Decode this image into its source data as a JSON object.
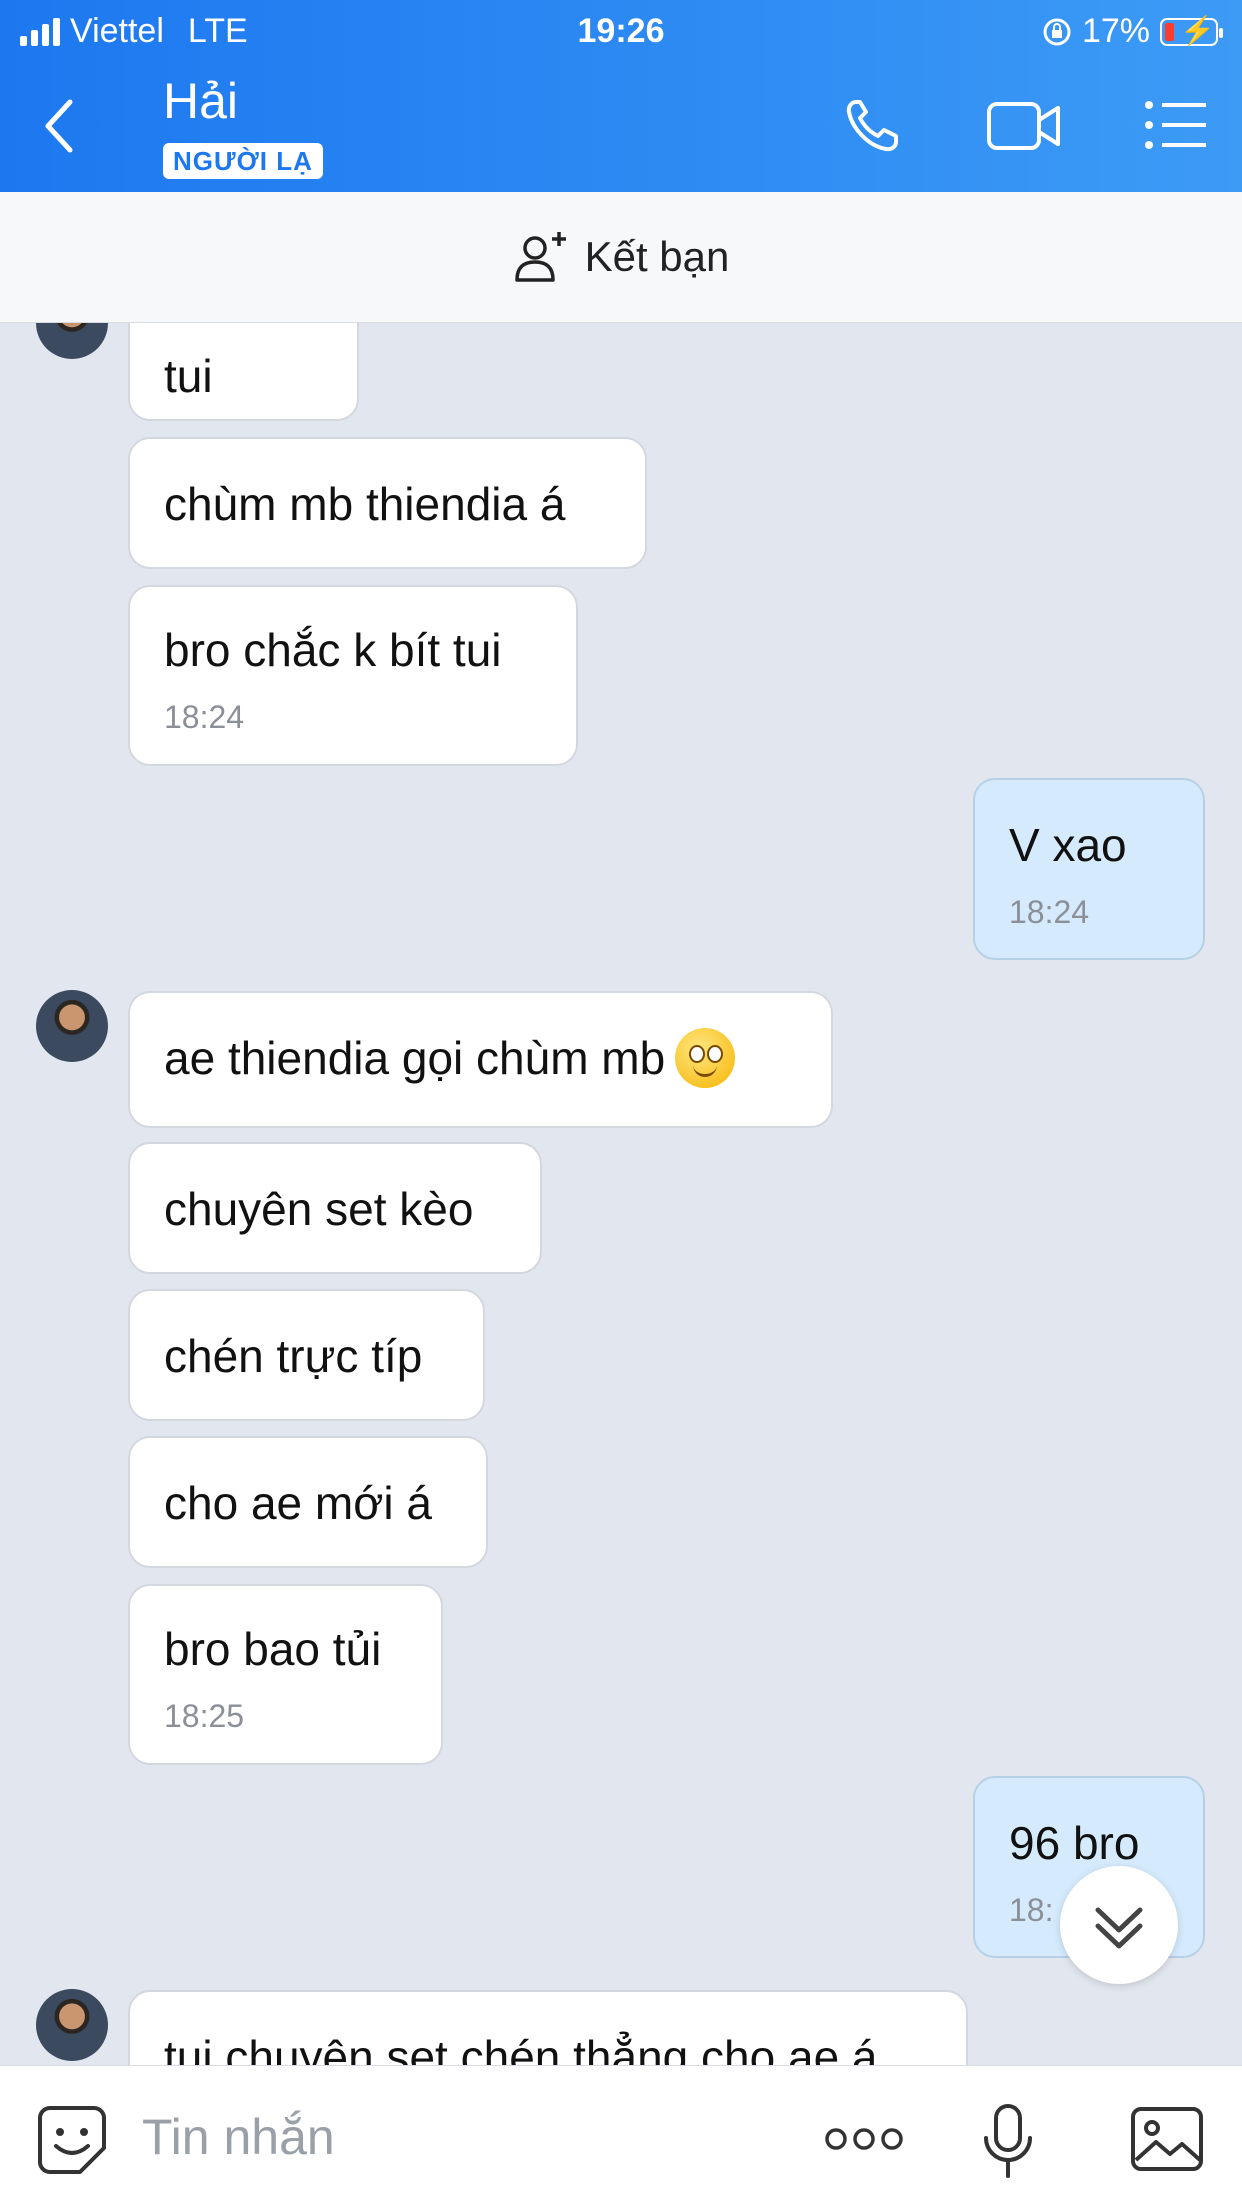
{
  "status_bar": {
    "carrier": "Viettel",
    "network": "LTE",
    "time": "19:26",
    "battery": "17%"
  },
  "header": {
    "contact_name": "Hải",
    "tag": "NGƯỜI LẠ"
  },
  "add_friend": {
    "label": "Kết bạn"
  },
  "messages": [
    {
      "from": "them",
      "text": "tui"
    },
    {
      "from": "them",
      "text": "chùm mb thiendia á"
    },
    {
      "from": "them",
      "text": "bro chắc k bít tui",
      "time": "18:24"
    },
    {
      "from": "me",
      "text": "V xao",
      "time": "18:24"
    },
    {
      "from": "them",
      "text": "ae thiendia gọi chùm mb",
      "emoji": "smile-emoji"
    },
    {
      "from": "them",
      "text": "chuyên set kèo"
    },
    {
      "from": "them",
      "text": "chén trực típ"
    },
    {
      "from": "them",
      "text": "cho ae mới á"
    },
    {
      "from": "them",
      "text": "bro bao tủi",
      "time": "18:25"
    },
    {
      "from": "me",
      "text": "96 bro",
      "time": "18:"
    },
    {
      "from": "them",
      "text": "tui chuyên set chén thẳng cho ae á"
    }
  ],
  "composer": {
    "placeholder": "Tin nhắn"
  },
  "colors": {
    "header": "#1d78f0",
    "my_bubble": "#d5ebfd",
    "their_bubble": "#ffffff",
    "background": "#e2e6ee"
  }
}
